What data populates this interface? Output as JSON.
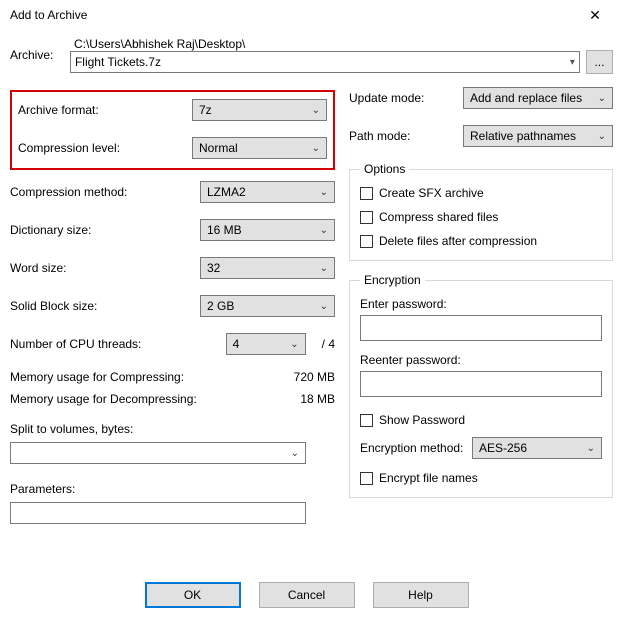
{
  "window": {
    "title": "Add to Archive"
  },
  "archive": {
    "label": "Archive:",
    "path": "C:\\Users\\Abhishek Raj\\Desktop\\",
    "filename": "Flight Tickets.7z",
    "browse": "..."
  },
  "left": {
    "format": {
      "label": "Archive format:",
      "value": "7z"
    },
    "level": {
      "label": "Compression level:",
      "value": "Normal"
    },
    "method": {
      "label": "Compression method:",
      "value": "LZMA2"
    },
    "dict": {
      "label": "Dictionary size:",
      "value": "16 MB"
    },
    "word": {
      "label": "Word size:",
      "value": "32"
    },
    "block": {
      "label": "Solid Block size:",
      "value": "2 GB"
    },
    "threads": {
      "label": "Number of CPU threads:",
      "value": "4",
      "total": "/ 4"
    },
    "mem_compress": {
      "label": "Memory usage for Compressing:",
      "value": "720 MB"
    },
    "mem_decompress": {
      "label": "Memory usage for Decompressing:",
      "value": "18 MB"
    },
    "split": {
      "label": "Split to volumes, bytes:"
    },
    "params": {
      "label": "Parameters:"
    }
  },
  "right": {
    "update": {
      "label": "Update mode:",
      "value": "Add and replace files"
    },
    "pathmode": {
      "label": "Path mode:",
      "value": "Relative pathnames"
    },
    "options": {
      "legend": "Options",
      "sfx": "Create SFX archive",
      "shared": "Compress shared files",
      "delete": "Delete files after compression"
    },
    "encryption": {
      "legend": "Encryption",
      "enter": "Enter password:",
      "reenter": "Reenter password:",
      "show": "Show Password",
      "method_label": "Encryption method:",
      "method_value": "AES-256",
      "encrypt_names": "Encrypt file names"
    }
  },
  "buttons": {
    "ok": "OK",
    "cancel": "Cancel",
    "help": "Help"
  }
}
